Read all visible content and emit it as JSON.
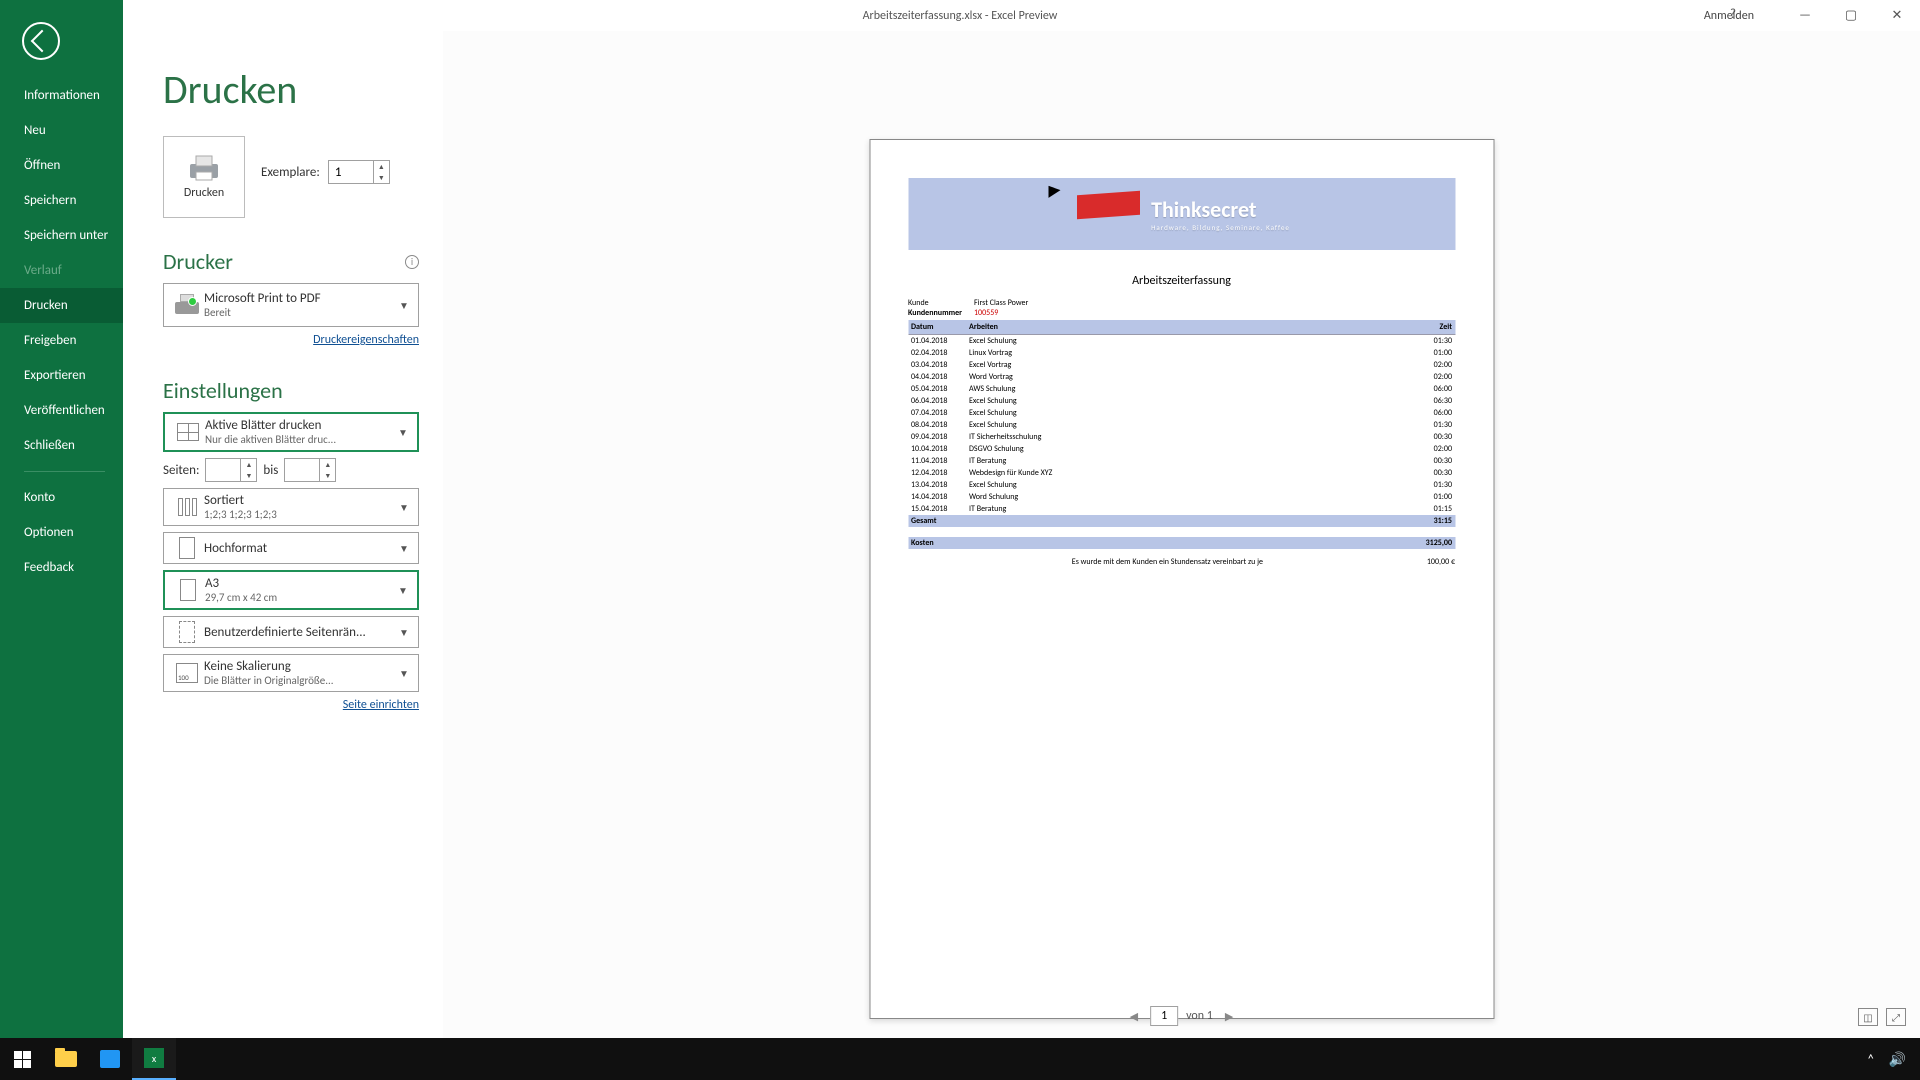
{
  "titlebar": {
    "title": "Arbeitszeiterfassung.xlsx  -  Excel Preview",
    "signin": "Anmelden",
    "help": "?"
  },
  "sidebar": {
    "items": [
      {
        "label": "Informationen"
      },
      {
        "label": "Neu"
      },
      {
        "label": "Öffnen"
      },
      {
        "label": "Speichern"
      },
      {
        "label": "Speichern unter"
      },
      {
        "label": "Verlauf",
        "disabled": true
      },
      {
        "label": "Drucken",
        "active": true
      },
      {
        "label": "Freigeben"
      },
      {
        "label": "Exportieren"
      },
      {
        "label": "Veröffentlichen"
      },
      {
        "label": "Schließen"
      }
    ],
    "footer": [
      {
        "label": "Konto"
      },
      {
        "label": "Optionen"
      },
      {
        "label": "Feedback"
      }
    ]
  },
  "print": {
    "heading": "Drucken",
    "button_label": "Drucken",
    "copies_label": "Exemplare:",
    "copies_value": "1"
  },
  "printer_section": {
    "heading": "Drucker",
    "name": "Microsoft Print to PDF",
    "status": "Bereit",
    "props_link": "Druckereigenschaften"
  },
  "settings": {
    "heading": "Einstellungen",
    "what": {
      "ln1": "Aktive Blätter drucken",
      "ln2": "Nur die aktiven Blätter druc..."
    },
    "pages_label": "Seiten:",
    "pages_to": "bis",
    "collate": {
      "ln1": "Sortiert",
      "ln2": "1;2;3    1;2;3    1;2;3"
    },
    "orient": {
      "ln1": "Hochformat"
    },
    "paper": {
      "ln1": "A3",
      "ln2": "29,7 cm x 42 cm"
    },
    "margins": {
      "ln1": "Benutzerdefinierte Seitenrän..."
    },
    "scaling": {
      "ln1": "Keine Skalierung",
      "ln2": "Die Blätter in Originalgröße..."
    },
    "setup_link": "Seite einrichten"
  },
  "preview_nav": {
    "page": "1",
    "of": "von 1"
  },
  "document": {
    "brand": "Thinksecret",
    "brand_sub": "Hardware, Bildung, Seminare, Kaffee",
    "title": "Arbeitszeiterfassung",
    "kunde_label": "Kunde",
    "kunde_value": "First Class Power",
    "nummer_label": "Kundennummer",
    "nummer_value": "100559",
    "headers": {
      "datum": "Datum",
      "arbeiten": "Arbeiten",
      "zeit": "Zeit"
    },
    "rows": [
      {
        "d": "01.04.2018",
        "a": "Excel Schulung",
        "z": "01:30"
      },
      {
        "d": "02.04.2018",
        "a": "Linux Vortrag",
        "z": "01:00"
      },
      {
        "d": "03.04.2018",
        "a": "Excel Vortrag",
        "z": "02:00"
      },
      {
        "d": "04.04.2018",
        "a": "Word Vortrag",
        "z": "02:00"
      },
      {
        "d": "05.04.2018",
        "a": "AWS Schulung",
        "z": "06:00"
      },
      {
        "d": "06.04.2018",
        "a": "Excel Schulung",
        "z": "06:30"
      },
      {
        "d": "07.04.2018",
        "a": "Excel Schulung",
        "z": "06:00"
      },
      {
        "d": "08.04.2018",
        "a": "Excel Schulung",
        "z": "01:30"
      },
      {
        "d": "09.04.2018",
        "a": "IT Sicherheitsschulung",
        "z": "00:30"
      },
      {
        "d": "10.04.2018",
        "a": "DSGVO Schulung",
        "z": "02:00"
      },
      {
        "d": "11.04.2018",
        "a": "IT Beratung",
        "z": "00:30"
      },
      {
        "d": "12.04.2018",
        "a": "Webdesign für Kunde XYZ",
        "z": "00:30"
      },
      {
        "d": "13.04.2018",
        "a": "Excel Schulung",
        "z": "01:30"
      },
      {
        "d": "14.04.2018",
        "a": "Word Schulung",
        "z": "01:00"
      },
      {
        "d": "15.04.2018",
        "a": "IT Beratung",
        "z": "01:15"
      }
    ],
    "total_label": "Gesamt",
    "total_value": "31:15",
    "cost_label": "Kosten",
    "cost_value": "3125,00",
    "note_text": "Es wurde mit dem Kunden ein Stundensatz vereinbart zu je",
    "note_value": "100,00 €"
  }
}
